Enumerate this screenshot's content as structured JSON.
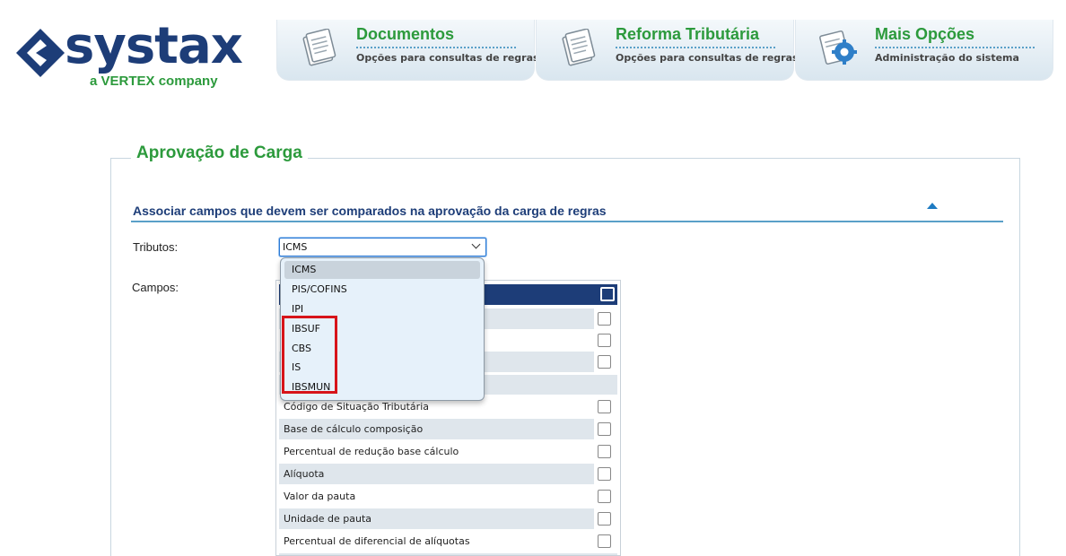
{
  "brand": {
    "name": "systax",
    "tagline": "a VERTEX company",
    "primary_color": "#1d3d78",
    "accent_color": "#2c9a3c"
  },
  "nav": [
    {
      "title": "Documentos",
      "subtitle": "Opções para consultas de regras",
      "icon": "document-icon"
    },
    {
      "title": "Reforma Tributária",
      "subtitle": "Opções para consultas de regras",
      "icon": "document-icon"
    },
    {
      "title": "Mais Opções",
      "subtitle": "Administração do sistema",
      "icon": "gear-icon"
    }
  ],
  "panel": {
    "title": "Aprovação de Carga",
    "section_title": "Associar campos que devem ser comparados na aprovação da carga de regras",
    "tributos_label": "Tributos:",
    "campos_label": "Campos:",
    "tributos_value": "ICMS"
  },
  "dropdown": {
    "options": [
      "ICMS",
      "PIS/COFINS",
      "IPI",
      "IBSUF",
      "CBS",
      "IS",
      "IBSMUN"
    ],
    "selected": "ICMS",
    "highlighted_options": [
      "IBSUF",
      "CBS",
      "IS",
      "IBSMUN"
    ],
    "highlight_color": "#d7141a"
  },
  "campos": [
    "Código de Situação Tributária",
    "Base de cálculo composição",
    "Percentual de redução base cálculo",
    "Alíquota",
    "Valor da pauta",
    "Unidade de pauta",
    "Percentual de diferencial de alíquotas"
  ]
}
